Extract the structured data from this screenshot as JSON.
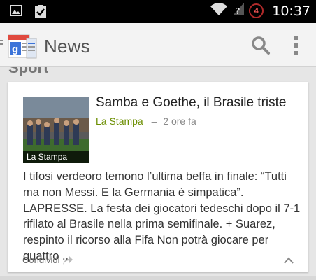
{
  "status_bar": {
    "time": "10:37",
    "notification_count": "4"
  },
  "app_bar": {
    "title": "News"
  },
  "section": {
    "title": "Sport"
  },
  "article": {
    "headline": "Samba e Goethe, il Brasile triste",
    "source": "La Stampa",
    "time": "2 ore fa",
    "meta_separator": "–",
    "thumbnail_caption": "La Stampa",
    "snippet": "I tifosi verdeoro temono l’ultima beffa in finale: “Tutti ma non Messi. E la Germania è simpatica”. LAPRESSE. La festa dei giocatori tedeschi dopo il 7-1 rifilato al Brasile nella prima semifinale. + Suarez, respinto il ricorso alla Fifa Non potrà giocare per quattro ...",
    "share_label": "Condividi"
  },
  "colors": {
    "source_green": "#6b8e00",
    "status_bar": "#000000",
    "action_bar": "#f3f3f3"
  }
}
